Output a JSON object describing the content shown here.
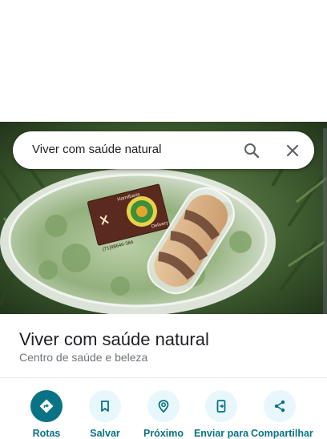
{
  "search": {
    "query": "Viver com saúde natural"
  },
  "place": {
    "name": "Viver com saúde natural",
    "category": "Centro de saúde e beleza"
  },
  "photo": {
    "card_brand": "Hamilbaria",
    "card_sub": "Delivery",
    "card_phone": "(71)98646-384"
  },
  "actions": [
    {
      "label": "Rotas",
      "icon": "directions-icon"
    },
    {
      "label": "Salvar",
      "icon": "bookmark-icon"
    },
    {
      "label": "Próximo",
      "icon": "nearby-icon"
    },
    {
      "label": "Enviar para",
      "icon": "send-to-phone-icon"
    },
    {
      "label": "Compartilhar",
      "icon": "share-icon"
    }
  ],
  "colors": {
    "accent": "#0a7285",
    "accent_light": "#e8f7fc",
    "title": "#202124",
    "subtitle": "#70757a"
  }
}
